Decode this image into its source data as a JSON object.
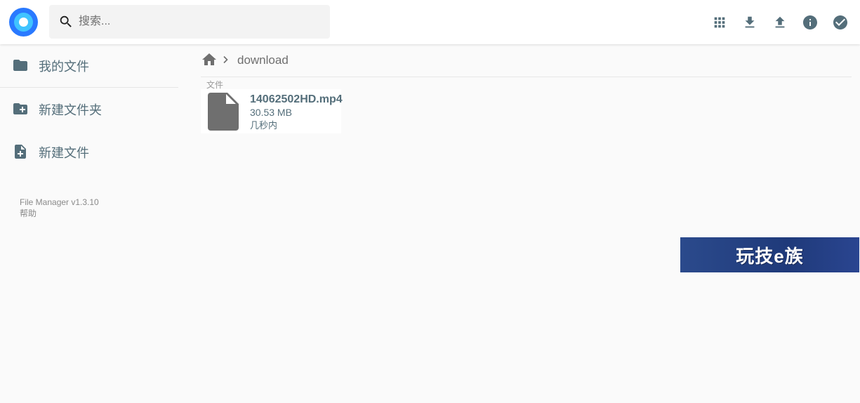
{
  "header": {
    "search_placeholder": "搜索..."
  },
  "icons": {
    "logo": "app-logo",
    "search": "search-icon",
    "view_toggle": "grid-view-icon",
    "download": "download-icon",
    "upload": "upload-icon",
    "info": "info-icon",
    "select": "check-circle-icon"
  },
  "sidebar": {
    "items": [
      {
        "label": "我的文件",
        "icon": "folder-icon"
      },
      {
        "label": "新建文件夹",
        "icon": "create-folder-icon"
      },
      {
        "label": "新建文件",
        "icon": "create-file-icon"
      }
    ],
    "credits": {
      "version": "File Manager v1.3.10",
      "help": "帮助"
    }
  },
  "breadcrumb": {
    "items": [
      "download"
    ]
  },
  "listing": {
    "section_label": "文件",
    "files": [
      {
        "name": "14062502HD.mp4",
        "size": "30.53 MB",
        "modified": "几秒内"
      }
    ]
  },
  "watermark": {
    "text": "玩技e族"
  },
  "colors": {
    "accent": "#546e7a",
    "logo_outer": "#2979ff",
    "logo_inner": "#40c4ff",
    "watermark_bg": "#1f3a7a"
  }
}
